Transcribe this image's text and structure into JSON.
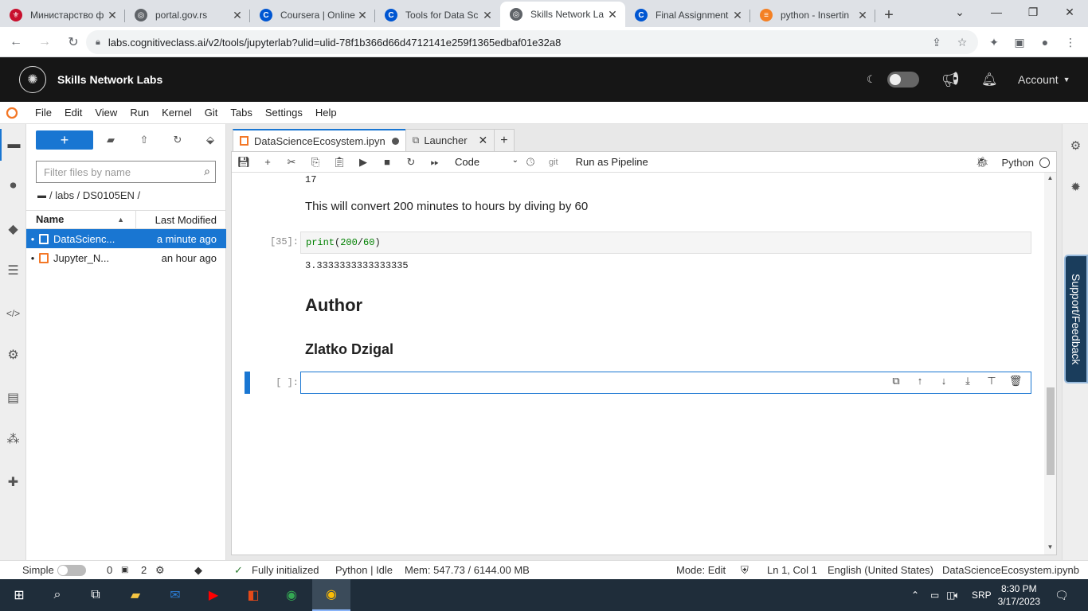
{
  "browser": {
    "tabs": [
      {
        "title": "Министарство ф",
        "icon_color": "#c8102e",
        "icon": "seal-icon"
      },
      {
        "title": "portal.gov.rs",
        "icon_color": "#5f6368",
        "icon": "globe-icon"
      },
      {
        "title": "Coursera | Online",
        "icon_color": "#0056d2",
        "icon": "coursera-icon"
      },
      {
        "title": "Tools for Data Sc",
        "icon_color": "#0056d2",
        "icon": "coursera-icon"
      },
      {
        "title": "Skills Network La",
        "icon_color": "#5f6368",
        "icon": "globe-icon",
        "active": true
      },
      {
        "title": "Final Assignment",
        "icon_color": "#0056d2",
        "icon": "coursera-icon"
      },
      {
        "title": "python - Insertin",
        "icon_color": "#f48024",
        "icon": "stackoverflow-icon"
      }
    ],
    "url": "labs.cognitiveclass.ai/v2/tools/jupyterlab?ulid=ulid-78f1b366d66d4712141e259f1365edbaf01e32a8"
  },
  "header": {
    "title": "Skills Network Labs",
    "account_label": "Account"
  },
  "menubar": {
    "items": [
      "File",
      "Edit",
      "View",
      "Run",
      "Kernel",
      "Git",
      "Tabs",
      "Settings",
      "Help"
    ]
  },
  "filebrowser": {
    "new_label": "+",
    "filter_placeholder": "Filter files by name",
    "breadcrumb": "/ labs / DS0105EN /",
    "col_name": "Name",
    "col_modified": "Last Modified",
    "files": [
      {
        "name": "DataScienc...",
        "modified": "a minute ago",
        "selected": true
      },
      {
        "name": "Jupyter_N...",
        "modified": "an hour ago",
        "selected": false
      }
    ]
  },
  "tabs": {
    "notebook": "DataScienceEcosystem.ipyn",
    "launcher": "Launcher"
  },
  "toolbar": {
    "cell_type": "Code",
    "git": "git",
    "pipeline": "Run as Pipeline",
    "kernel": "Python"
  },
  "notebook": {
    "output_prev": "17",
    "markdown_text": "This will convert 200 minutes to hours by diving by 60",
    "code_prompt": "[35]:",
    "code_fn": "print",
    "code_num1": "200",
    "code_op": "/",
    "code_num2": "60",
    "code_output": "3.3333333333333335",
    "heading1": "Author",
    "heading2": "Zlatko Dzigal",
    "empty_prompt": "[ ]:"
  },
  "support": "Support/Feedback",
  "statusbar": {
    "mode_simple": "Simple",
    "terminals": "0",
    "kernels": "2",
    "status": "Fully initialized",
    "kernel_state": "Python | Idle",
    "memory": "Mem: 547.73 / 6144.00 MB",
    "mode": "Mode: Edit",
    "cursor": "Ln 1, Col 1",
    "language": "English (United States)",
    "filename": "DataScienceEcosystem.ipynb"
  },
  "taskbar": {
    "lang": "SRP",
    "time": "8:30 PM",
    "date": "3/17/2023"
  }
}
